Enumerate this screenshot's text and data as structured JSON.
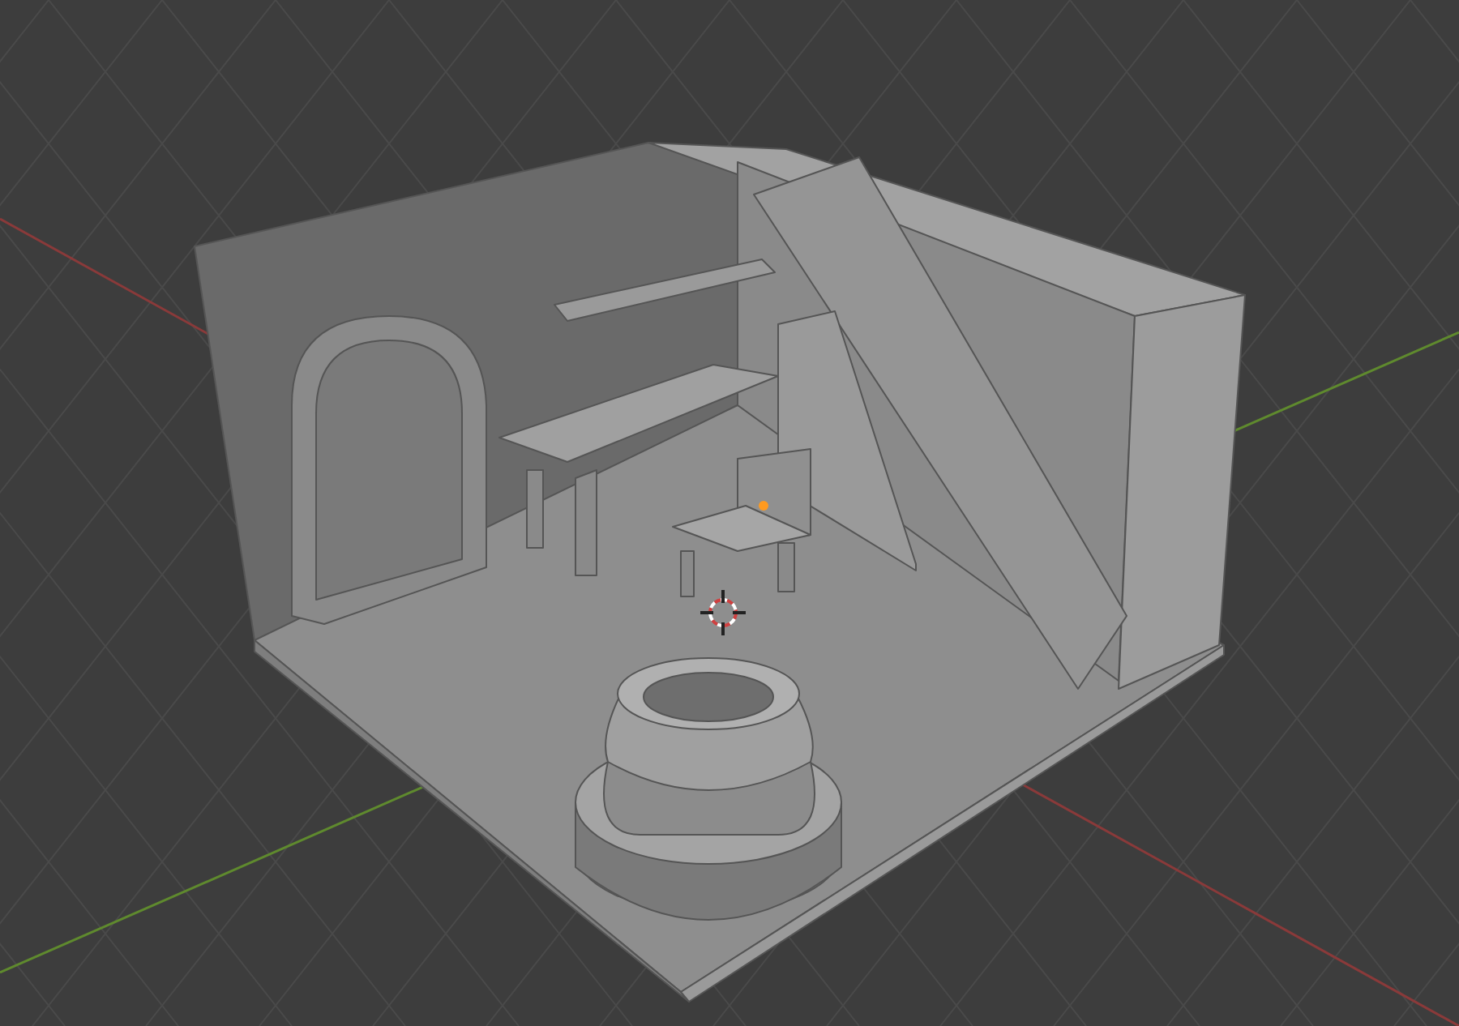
{
  "viewport": {
    "kind": "room-scene",
    "grid": true
  }
}
